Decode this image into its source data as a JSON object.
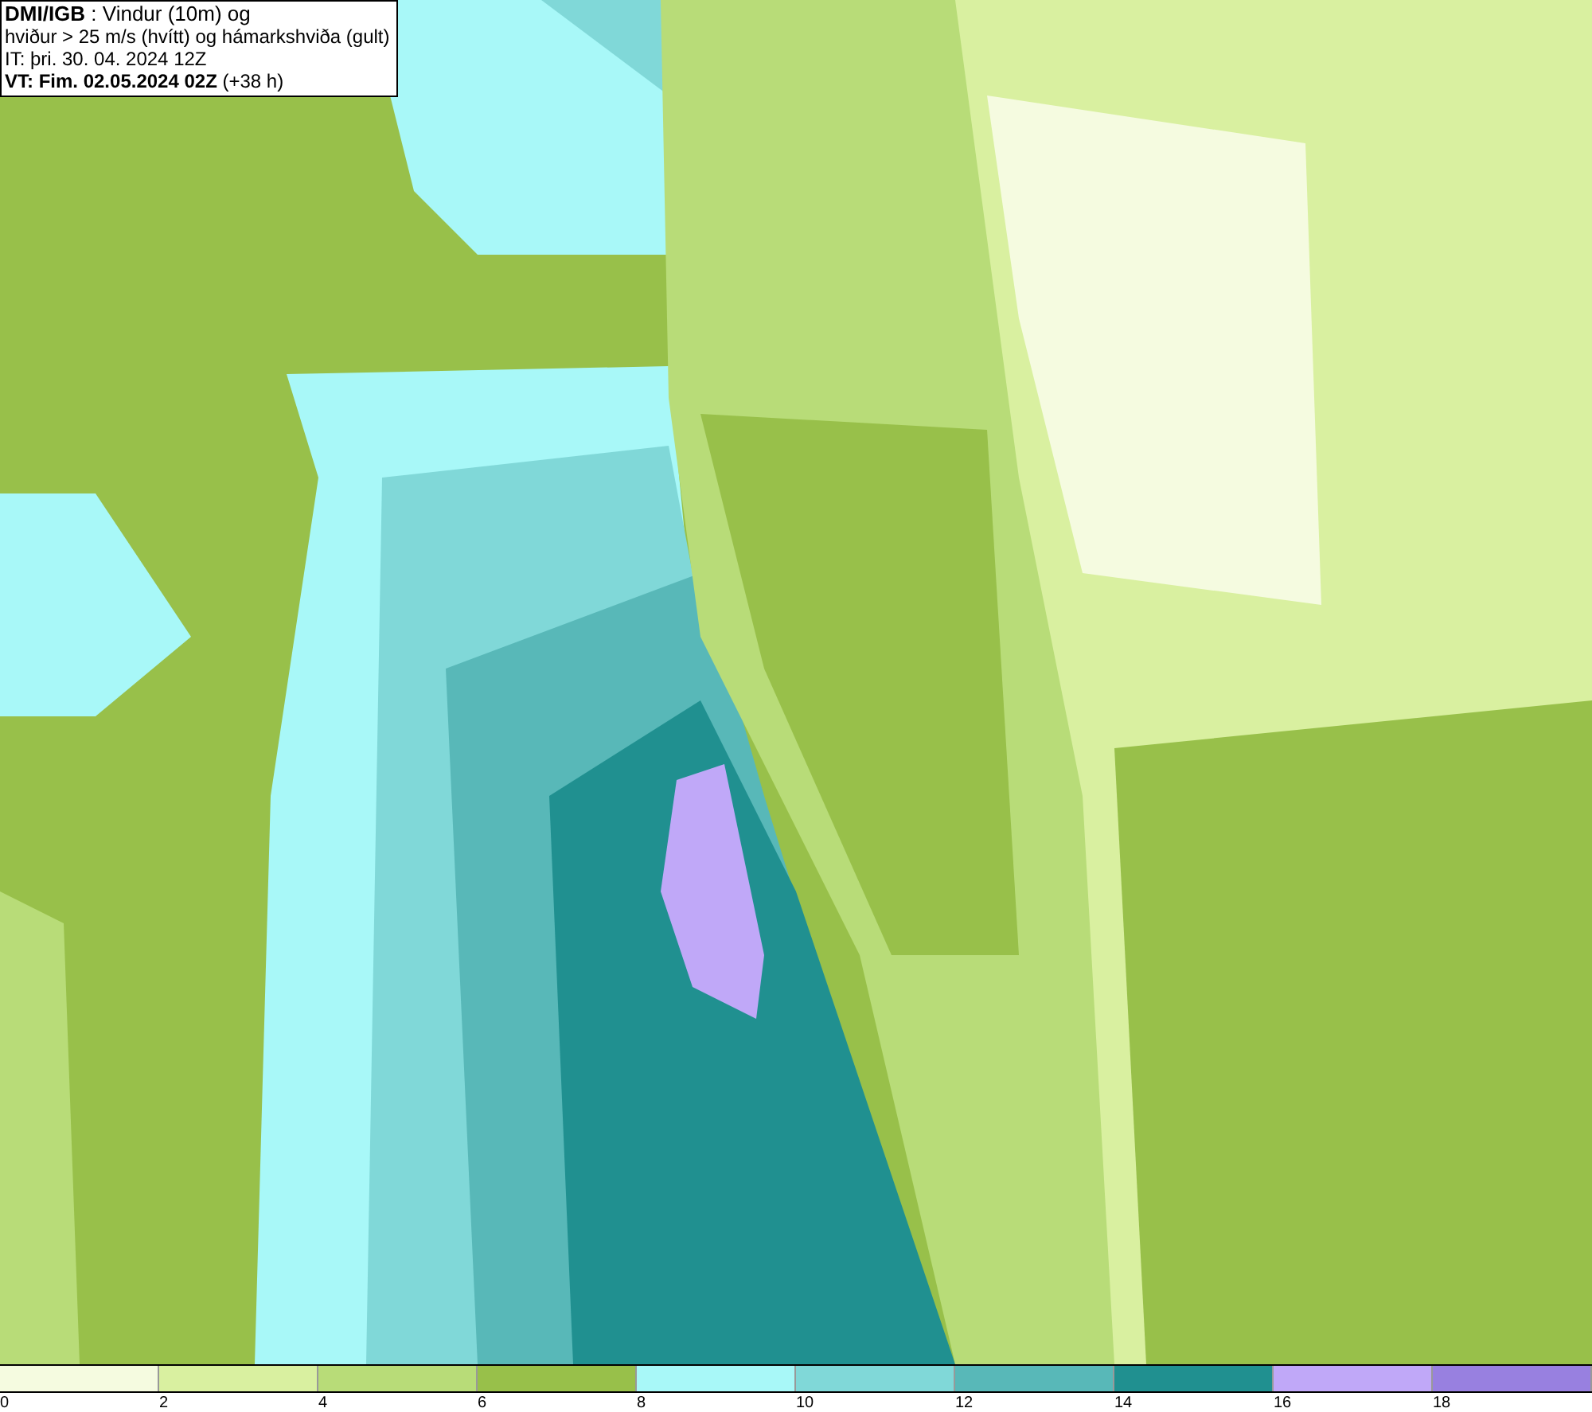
{
  "title_box": {
    "lines": [
      "**DMI/IGB** : Vindur (10m) og",
      "hviður > 25 m/s (hvítt) og hámarkshviða (gult)",
      "IT: þri. 30. 04. 2024 12Z",
      "**VT: Fim. 02.05.2024 02Z** (+38 h)"
    ]
  },
  "legend": {
    "bins": [
      {
        "label": "0",
        "color": "#f5fbe0"
      },
      {
        "label": "2",
        "color": "#d9f0a0"
      },
      {
        "label": "4",
        "color": "#b8dc78"
      },
      {
        "label": "6",
        "color": "#98c04a"
      },
      {
        "label": "8",
        "color": "#a8f8f8"
      },
      {
        "label": "10",
        "color": "#80d8d8"
      },
      {
        "label": "12",
        "color": "#58b8b8"
      },
      {
        "label": "14",
        "color": "#209090"
      },
      {
        "label": "16",
        "color": "#c0a8f8"
      },
      {
        "label": "18",
        "color": "#9880e0"
      }
    ]
  }
}
